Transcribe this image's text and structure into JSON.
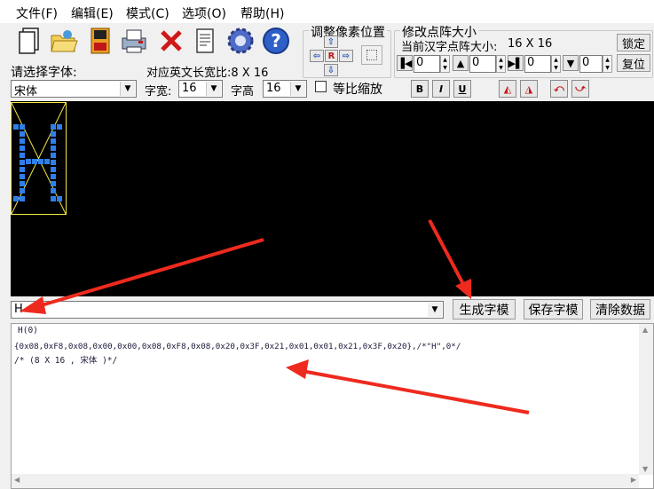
{
  "menu": [
    "文件(F)",
    "编辑(E)",
    "模式(C)",
    "选项(O)",
    "帮助(H)"
  ],
  "font_section": {
    "label": "请选择字体:",
    "font_value": "宋体",
    "width_label": "字宽:",
    "width_value": "16",
    "height_label": "字高",
    "height_value": "16",
    "ratio_label": "等比缩放",
    "ascii_ratio_text": "对应英文长宽比:8 X 16"
  },
  "pixel_position": {
    "title": "调整像素位置",
    "center_glyph": "R"
  },
  "dot_size": {
    "title": "修改点阵大小",
    "current_label": "当前汉字点阵大小:",
    "current_value": "16 X 16",
    "lock_label": "锁定",
    "reset_label": "复位",
    "spin_values": [
      "0",
      "0",
      "0",
      "0"
    ]
  },
  "format_buttons": [
    "B",
    "I",
    "U"
  ],
  "input_row": {
    "value": "H",
    "generate_label": "生成字模",
    "save_label": "保存字模",
    "clear_label": "清除数据"
  },
  "output": {
    "line1": "H(0)",
    "line2": "{0x08,0xF8,0x08,0x00,0x00,0x08,0xF8,0x08,0x20,0x3F,0x21,0x01,0x01,0x21,0x3F,0x20},/*\"H\",0*/",
    "line3": "/* (8 X 16 , 宋体 )*/"
  },
  "colors": {
    "annotation_arrow": "#ee2a1e",
    "glyph_border": "#f5e942",
    "pixel": "#2f7fe8"
  }
}
